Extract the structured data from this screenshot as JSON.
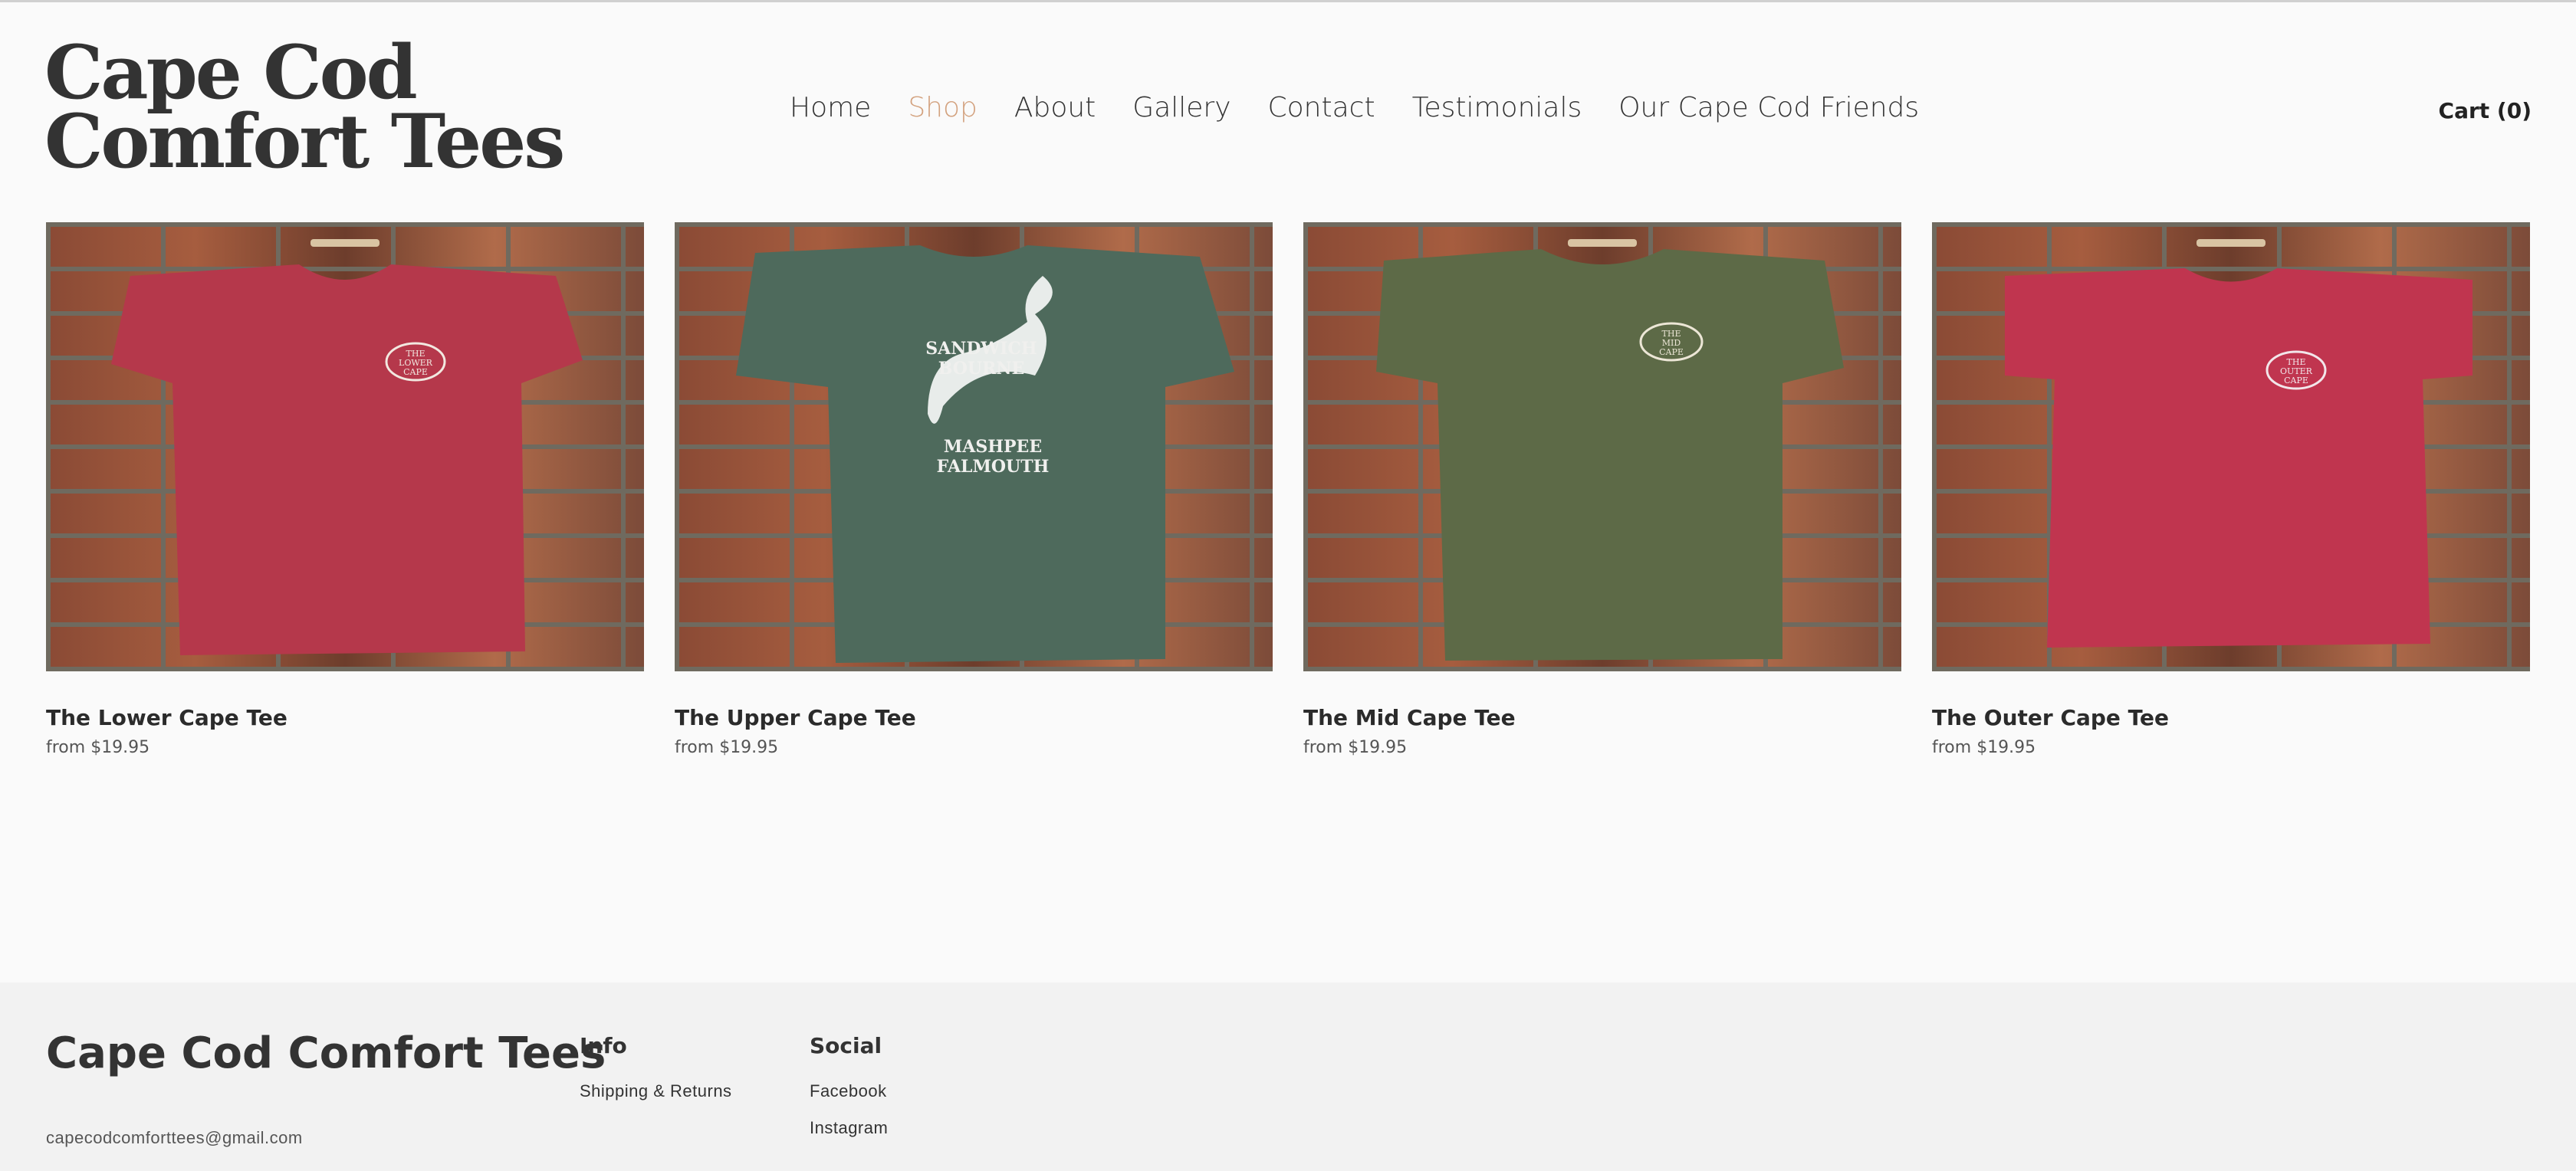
{
  "header": {
    "logo": "Cape Cod Comfort Tees",
    "nav": [
      {
        "label": "Home"
      },
      {
        "label": "Shop",
        "active": true
      },
      {
        "label": "About"
      },
      {
        "label": "Gallery"
      },
      {
        "label": "Contact"
      },
      {
        "label": "Testimonials"
      },
      {
        "label": "Our Cape Cod Friends"
      }
    ],
    "cart": "Cart (0)"
  },
  "products": [
    {
      "title": "The Lower Cape Tee",
      "price": "from $19.95",
      "shirt_color": "#b5384b",
      "emblem": [
        "THE",
        "LOWER",
        "CAPE"
      ]
    },
    {
      "title": "The Upper Cape Tee",
      "price": "from $19.95",
      "shirt_color": "#4e6a5c",
      "emblem": [
        "SANDWICH",
        "BOURNE",
        "MASHPEE",
        "FALMOUTH"
      ]
    },
    {
      "title": "The Mid Cape Tee",
      "price": "from $19.95",
      "shirt_color": "#5d6a47",
      "emblem": [
        "THE",
        "MID",
        "CAPE"
      ]
    },
    {
      "title": "The Outer Cape Tee",
      "price": "from $19.95",
      "shirt_color": "#c0354f",
      "emblem": [
        "THE",
        "OUTER",
        "CAPE"
      ]
    }
  ],
  "footer": {
    "brand": "Cape Cod Comfort Tees",
    "email": "capecodcomforttees@gmail.com",
    "info": {
      "heading": "Info",
      "links": [
        "Shipping & Returns"
      ]
    },
    "social": {
      "heading": "Social",
      "links": [
        "Facebook",
        "Instagram"
      ]
    }
  },
  "colors": {
    "accent": "#d3a27f",
    "background": "#fafafa",
    "footer_bg": "#f2f2f2"
  }
}
